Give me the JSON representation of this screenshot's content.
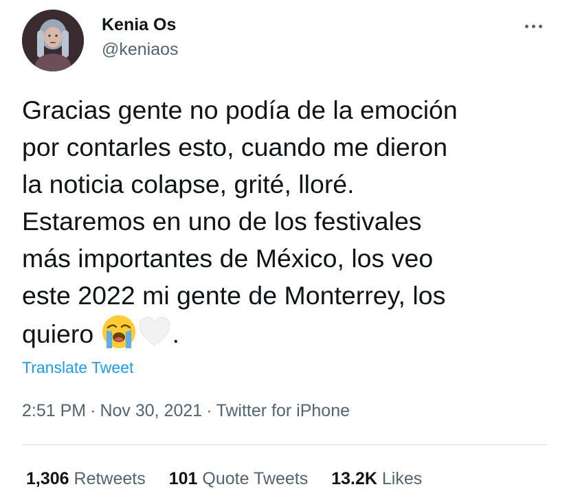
{
  "user": {
    "display_name": "Kenia Os",
    "handle": "@keniaos"
  },
  "tweet": {
    "text": "Gracias gente no podía de la emoción\npor contarles esto, cuando me dieron\nla noticia colapse, grité, lloré.\nEstaremos en uno de los festivales\nmás importantes de México, los veo\neste 2022 mi gente de Monterrey, los\nquiero ",
    "emojis": [
      "loudly-crying-face-icon",
      "white-heart-icon"
    ],
    "trailing": ".",
    "translate_label": "Translate Tweet"
  },
  "meta": {
    "time": "2:51 PM",
    "separator": "·",
    "date": "Nov 30, 2021",
    "source": "Twitter for iPhone"
  },
  "stats": {
    "retweets_count": "1,306",
    "retweets_label": "Retweets",
    "quotes_count": "101",
    "quotes_label": "Quote Tweets",
    "likes_count": "13.2K",
    "likes_label": "Likes"
  },
  "colors": {
    "text": "#0f1419",
    "secondary": "#536471",
    "link": "#1d9bf0",
    "divider": "#cfd9de"
  }
}
